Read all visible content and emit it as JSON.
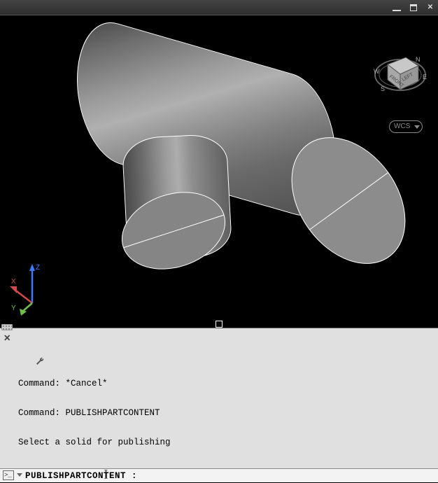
{
  "title_bar": {
    "minimize_tooltip": "Minimize",
    "restore_tooltip": "Restore Down",
    "close_tooltip": "Close"
  },
  "ucs": {
    "x_label": "X",
    "y_label": "Y",
    "z_label": "Z"
  },
  "viewcube": {
    "front_label": "FRONT",
    "left_label": "LEFT",
    "wcs_label": "WCS",
    "compass": {
      "n": "N",
      "s": "S",
      "e": "E",
      "w": "W"
    }
  },
  "command_history": [
    "Command: *Cancel*",
    "Command: PUBLISHPARTCONTENT",
    "Select a solid for publishing"
  ],
  "command_line": {
    "prompt_icon": ">_",
    "prompt_text": "PUBLISHPARTCONTENT :",
    "input_value": ""
  }
}
